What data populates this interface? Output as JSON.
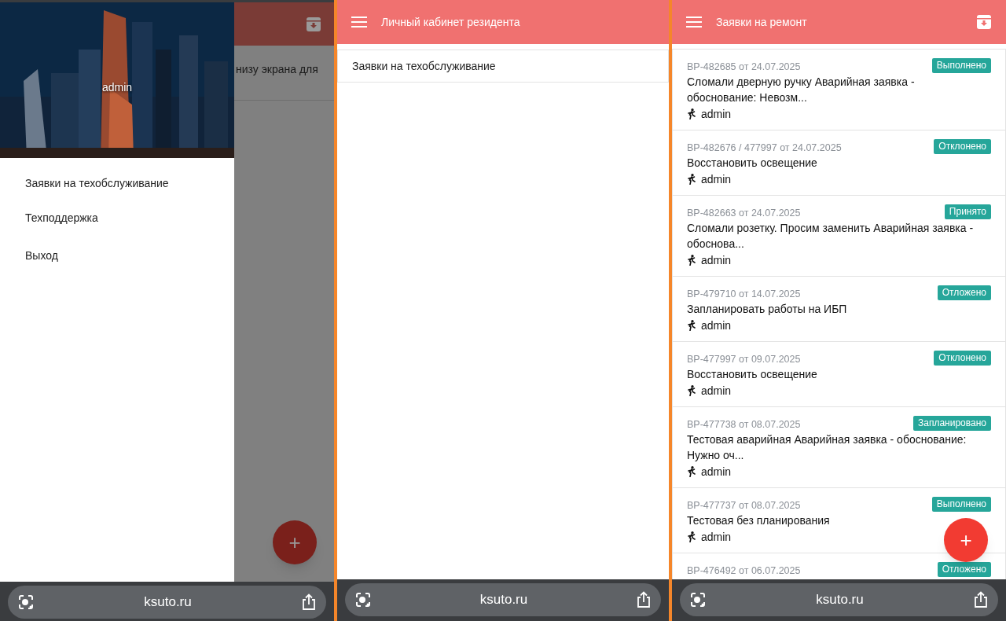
{
  "drawer_screen": {
    "background_text": "низу экрана для",
    "drawer": {
      "user": "admin",
      "items": [
        "Заявки на техобслуживание",
        "Техподдержка",
        "Выход"
      ]
    },
    "fab": "+",
    "url": "ksuto.ru"
  },
  "home_screen": {
    "title": "Личный кабинет резидента",
    "items": [
      "Заявки на техобслуживание"
    ],
    "url": "ksuto.ru"
  },
  "requests_screen": {
    "title": "Заявки на ремонт",
    "requests": [
      {
        "number": "ВР-482685 от 24.07.2025",
        "status": "Выполнено",
        "title": "Сломали дверную ручку Аварийная заявка - обоснование: Невозм...",
        "author": "admin"
      },
      {
        "number": "ВР-482676 / 477997 от 24.07.2025",
        "status": "Отклонено",
        "title": "Восстановить освещение",
        "author": "admin"
      },
      {
        "number": "ВР-482663 от 24.07.2025",
        "status": "Принято",
        "title": "Сломали розетку. Просим заменить Аварийная заявка - обоснова...",
        "author": "admin"
      },
      {
        "number": "ВР-479710 от 14.07.2025",
        "status": "Отложено",
        "title": "Запланировать работы на ИБП",
        "author": "admin"
      },
      {
        "number": "ВР-477997 от 09.07.2025",
        "status": "Отклонено",
        "title": "Восстановить освещение",
        "author": "admin"
      },
      {
        "number": "ВР-477738 от 08.07.2025",
        "status": "Запланировано",
        "title": "Тестовая аварийная Аварийная заявка - обоснование: Нужно оч...",
        "author": "admin"
      },
      {
        "number": "ВР-477737 от 08.07.2025",
        "status": "Выполнено",
        "title": "Тестовая без планирования",
        "author": "admin"
      },
      {
        "number": "ВР-476492 от 06.07.2025",
        "status": "Отложено"
      }
    ],
    "fab": "+",
    "url": "ksuto.ru"
  }
}
